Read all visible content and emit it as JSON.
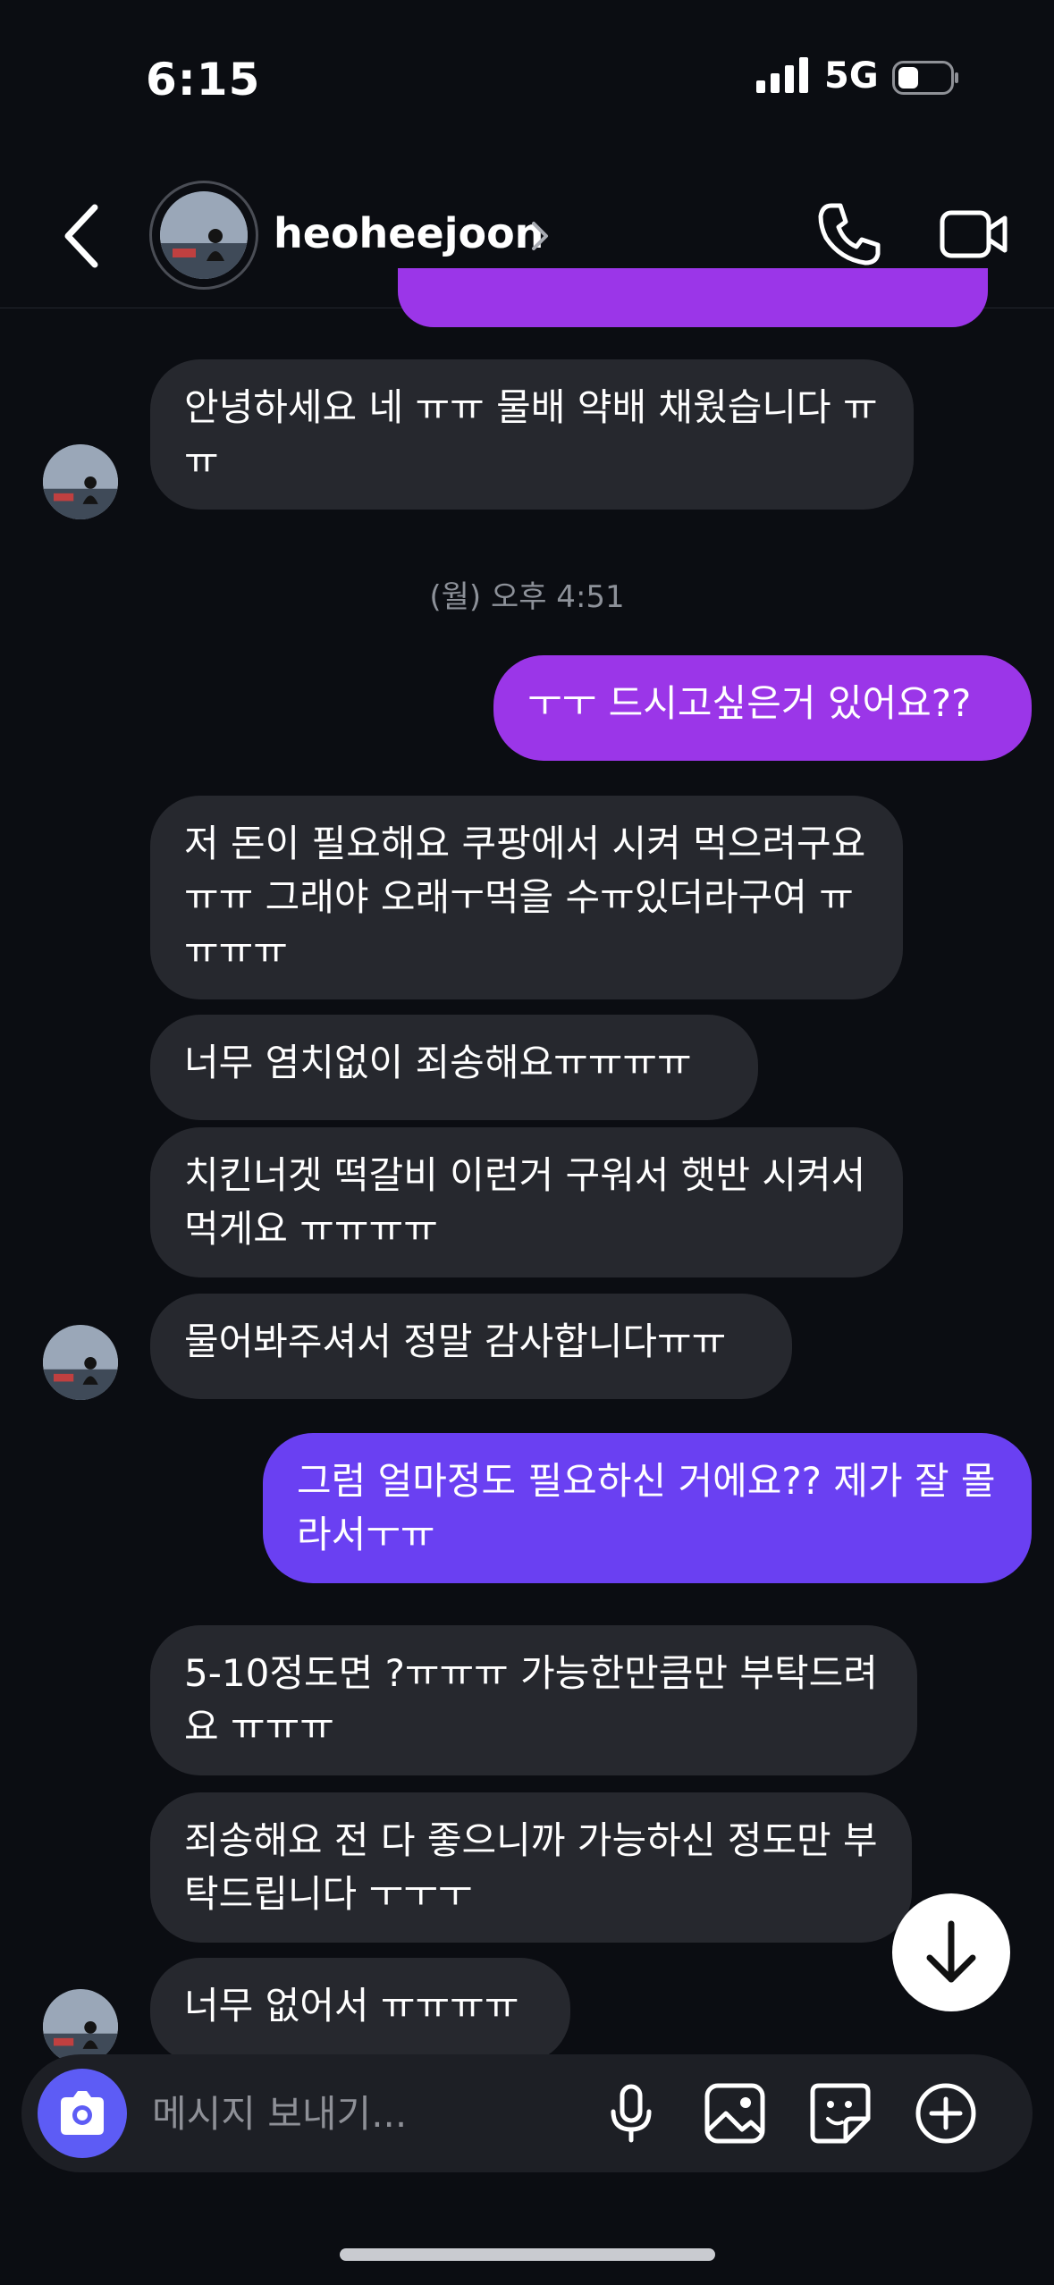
{
  "status_bar": {
    "time": "6:15",
    "network": "5G"
  },
  "header": {
    "username": "heoheejoon"
  },
  "messages": {
    "m1": "안녕하세요 네 ㅠㅠ 물배 약배 채웠습니다 ㅠㅠ",
    "timestamp": "(월) 오후 4:51",
    "m2": "ㅜㅜ 드시고싶은거 있어요??",
    "m3": "저 돈이 필요해요 쿠팡에서 시켜 먹으려구요 ㅠㅠ 그래야 오래ㅜ먹을 수ㅠ있더라구여 ㅠㅠㅠㅠ",
    "m4": "너무 염치없이 죄송해요ㅠㅠㅠㅠ",
    "m5": "치킨너겟 떡갈비 이런거 구워서 햇반 시켜서 먹게요 ㅠㅠㅠㅠ",
    "m6": "물어봐주셔서 정말 감사합니다ㅠㅠ",
    "m7": "그럼 얼마정도 필요하신 거에요?? 제가 잘 몰라서ㅜㅠ",
    "m8": "5-10정도면 ?ㅠㅠㅠ 가능한만큼만 부탁드려요 ㅠㅠㅠ",
    "m9": "죄송해요 전 다 좋으니까 가능하신 정도만 부탁드립니다 ㅜㅜㅜ",
    "m10": "너무 없어서 ㅠㅠㅠㅠ"
  },
  "composer": {
    "placeholder": "메시지 보내기..."
  },
  "colors": {
    "outgoing_purple": "#9b36e8",
    "outgoing_violet": "#6a40f2",
    "incoming": "#26282e",
    "camera": "#5d5cf5"
  }
}
